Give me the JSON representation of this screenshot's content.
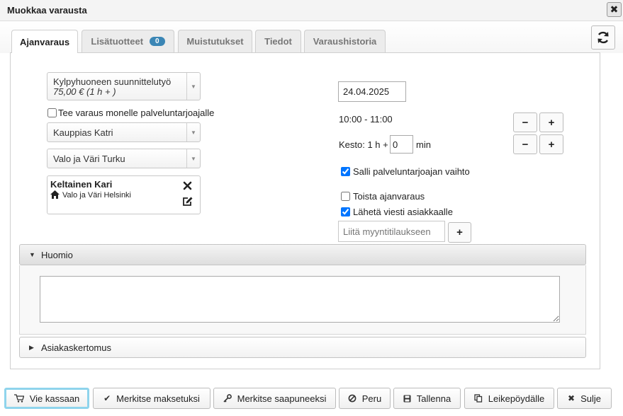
{
  "dialog": {
    "title": "Muokkaa varausta"
  },
  "tabs": [
    {
      "label": "Ajanvaraus"
    },
    {
      "label": "Lisätuotteet",
      "badge": "0"
    },
    {
      "label": "Muistutukset"
    },
    {
      "label": "Tiedot"
    },
    {
      "label": "Varaushistoria"
    }
  ],
  "service": {
    "name": "Kylpyhuoneen suunnittelutyö",
    "detail": "75,00 € (1 h + )"
  },
  "multi_provider": {
    "label": "Tee varaus monelle palveluntarjoajalle",
    "checked": false
  },
  "provider_select": {
    "value": "Kauppias Katri"
  },
  "location_select": {
    "value": "Valo ja Väri Turku"
  },
  "customer": {
    "name": "Keltainen Kari",
    "location": "Valo ja Väri Helsinki"
  },
  "date": {
    "value": "24.04.2025"
  },
  "time_range": "10:00 - 11:00",
  "duration": {
    "prefix": "Kesto: 1 h +",
    "minutes": "0",
    "unit": "min"
  },
  "allow_switch": {
    "label": "Salli palveluntarjoajan vaihto",
    "checked": true
  },
  "repeat": {
    "label": "Toista ajanvaraus",
    "checked": false
  },
  "send_message": {
    "label": "Lähetä viesti asiakkaalle",
    "checked": true
  },
  "sales_order": {
    "placeholder": "Liitä myyntitilaukseen"
  },
  "sections": {
    "note": "Huomio",
    "customer_report": "Asiakaskertomus"
  },
  "symbols": {
    "minus": "−",
    "plus": "+",
    "close": "✖"
  },
  "footer": {
    "to_checkout": "Vie kassaan",
    "mark_paid": "Merkitse maksetuksi",
    "mark_arrived": "Merkitse saapuneeksi",
    "cancel": "Peru",
    "save": "Tallenna",
    "clipboard": "Leikepöydälle",
    "close": "Sulje"
  },
  "colors": {
    "badge": "#3b86b5",
    "highlight_border": "#8fd4ec"
  }
}
